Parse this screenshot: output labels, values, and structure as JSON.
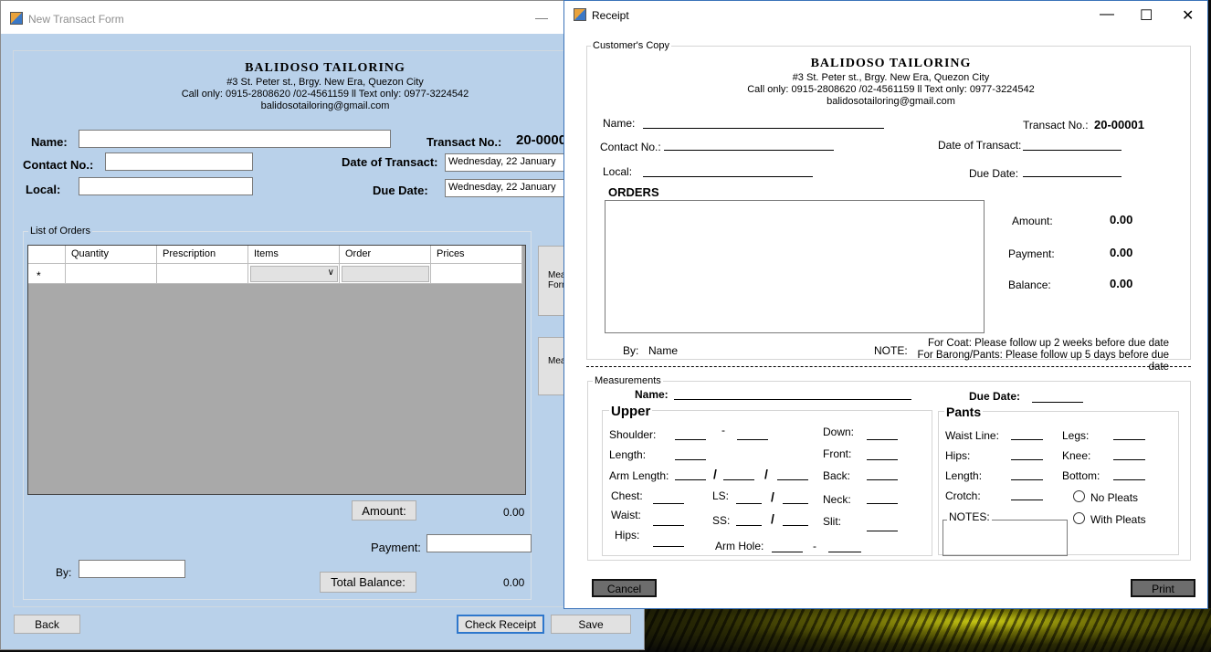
{
  "transact": {
    "title": "New Transact Form",
    "header": {
      "shop": "BALIDOSO TAILORING",
      "address": "#3 St. Peter st., Brgy. New Era, Quezon City",
      "contact": "Call only: 0915-2808620 /02-4561159 ll Text only: 0977-3224542",
      "email": "balidosotailoring@gmail.com"
    },
    "labels": {
      "name": "Name:",
      "contact_no": "Contact No.:",
      "local": "Local:",
      "transact_no": "Transact No.:",
      "date_of_transact": "Date of Transact:",
      "due_date": "Due Date:",
      "list_of_orders": "List of Orders",
      "payment": "Payment:",
      "by": "By:"
    },
    "values": {
      "transact_no": "20-0000",
      "date_of_transact": "Wednesday, 22   January",
      "due_date": "Wednesday, 22   January",
      "amount": "0.00",
      "total_balance": "0.00",
      "name": "",
      "contact_no": "",
      "local": "",
      "payment": "",
      "by": ""
    },
    "grid": {
      "columns": [
        "Quantity",
        "Prescription",
        "Items",
        "Order",
        "Prices"
      ],
      "new_row_marker": "*"
    },
    "side_buttons": [
      "Mea\nForm",
      "Mea"
    ],
    "buttons": {
      "amount": "Amount:",
      "total_balance": "Total Balance:",
      "back": "Back",
      "check_receipt": "Check Receipt",
      "save": "Save"
    }
  },
  "receipt": {
    "title": "Receipt",
    "copy_label": "Customer's Copy",
    "header": {
      "shop": "BALIDOSO TAILORING",
      "address": "#3 St. Peter st., Brgy. New Era, Quezon City",
      "contact": "Call only: 0915-2808620 /02-4561159 ll Text only: 0977-3224542",
      "email": "balidosotailoring@gmail.com"
    },
    "labels": {
      "name": "Name:",
      "contact_no": "Contact No.:",
      "local": "Local:",
      "transact_no": "Transact No.:",
      "date_of_transact": "Date of Transact:",
      "due_date": "Due Date:",
      "orders": "ORDERS",
      "amount": "Amount:",
      "payment": "Payment:",
      "balance": "Balance:",
      "by": "By:",
      "note": "NOTE:"
    },
    "values": {
      "transact_no": "20-00001",
      "amount": "0.00",
      "payment": "0.00",
      "balance": "0.00",
      "by_name": "Name"
    },
    "notes": [
      "For Coat: Please follow up 2 weeks before due date",
      "For Barong/Pants: Please follow up 5 days before due date"
    ],
    "measurements": {
      "group_label": "Measurements",
      "name_label": "Name:",
      "due_date_label": "Due Date:",
      "upper": {
        "title": "Upper",
        "shoulder": "Shoulder:",
        "length": "Length:",
        "arm_length": "Arm Length:",
        "chest": "Chest:",
        "waist": "Waist:",
        "hips": "Hips:",
        "ls": "LS:",
        "ss": "SS:",
        "arm_hole": "Arm Hole:",
        "down": "Down:",
        "front": "Front:",
        "back": "Back:",
        "neck": "Neck:",
        "slit": "Slit:",
        "dash": "-",
        "slash": "/"
      },
      "pants": {
        "title": "Pants",
        "waist_line": "Waist Line:",
        "hips": "Hips:",
        "length": "Length:",
        "crotch": "Crotch:",
        "legs": "Legs:",
        "knee": "Knee:",
        "bottom": "Bottom:",
        "no_pleats": "No Pleats",
        "with_pleats": "With Pleats",
        "notes": "NOTES:"
      }
    },
    "buttons": {
      "cancel": "Cancel",
      "print": "Print"
    },
    "window_controls": {
      "min": "—",
      "max": "☐",
      "close": "✕"
    }
  }
}
